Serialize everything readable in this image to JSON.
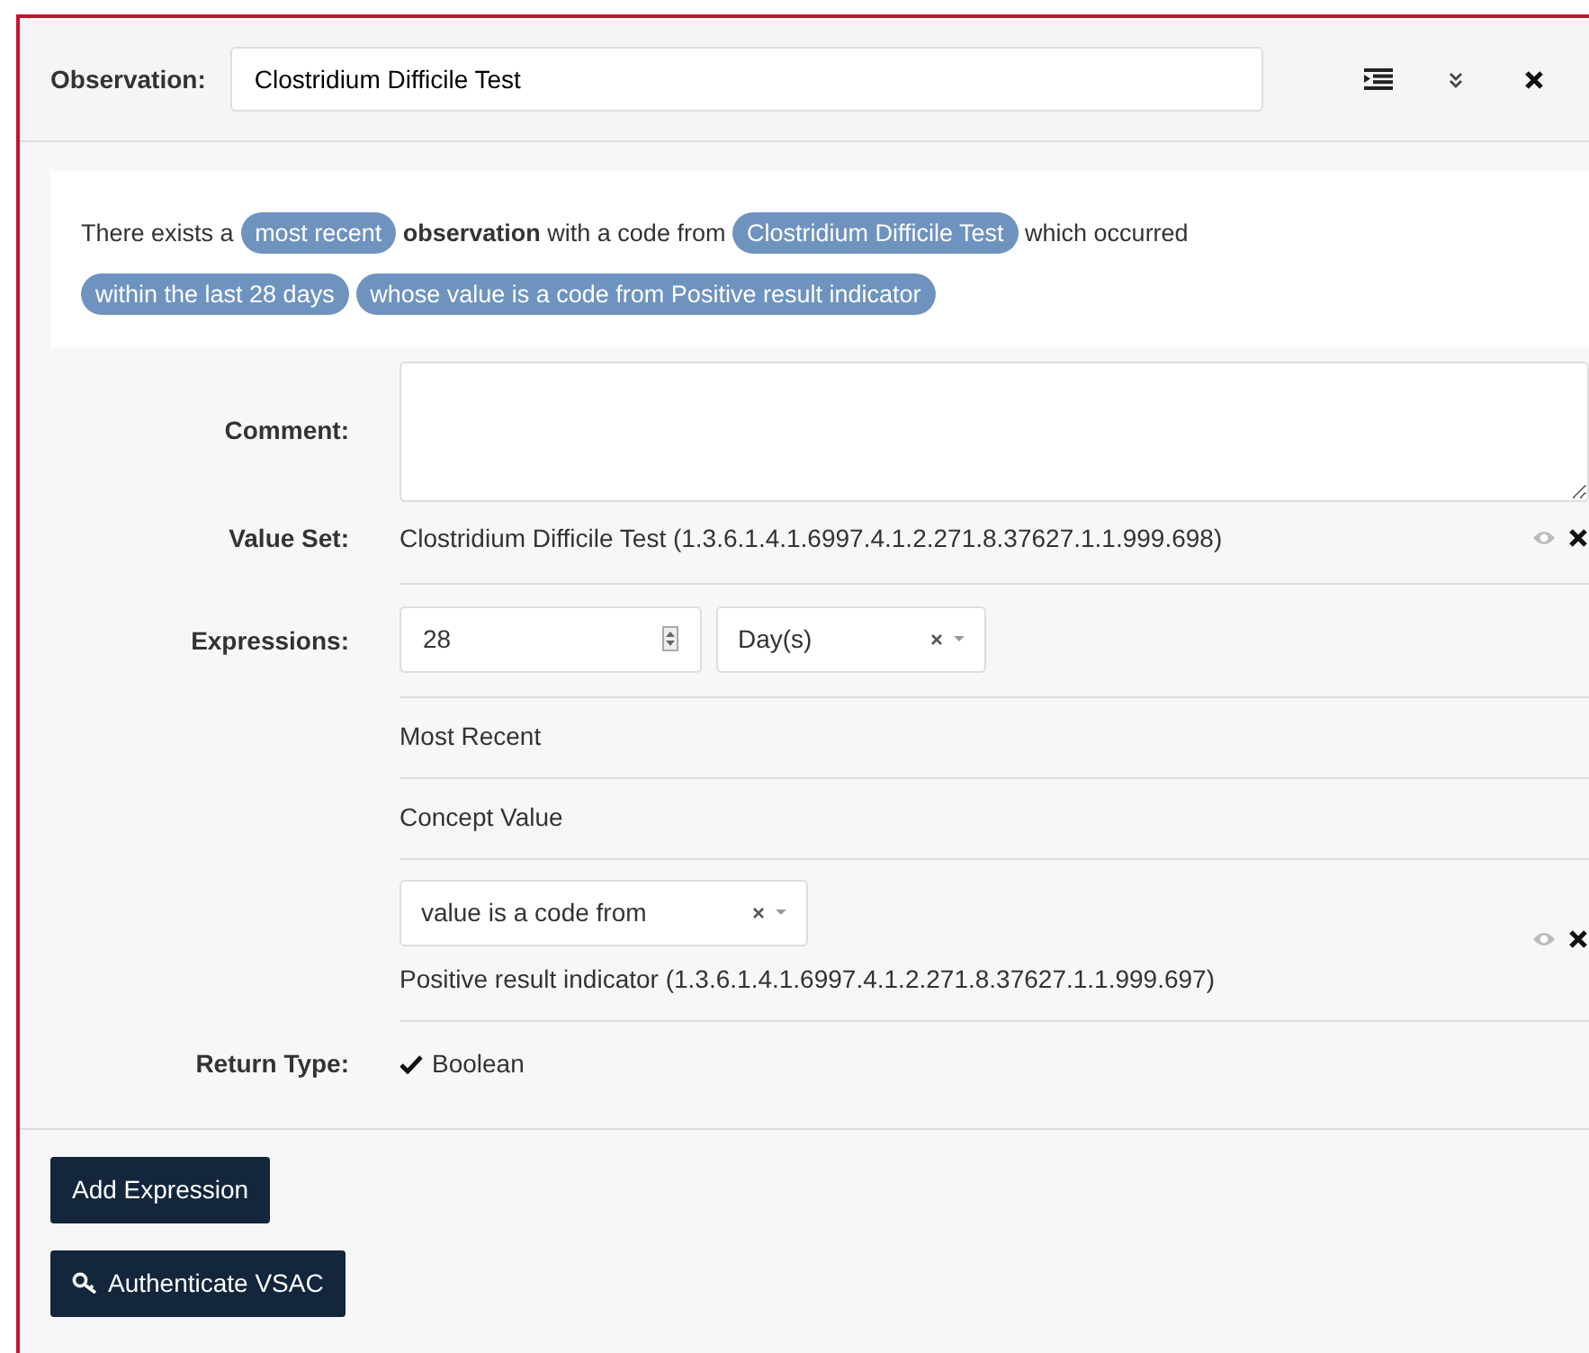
{
  "header": {
    "label": "Observation:",
    "value": "Clostridium Difficile Test"
  },
  "summary": [
    {
      "kind": "text",
      "text": "There exists a"
    },
    {
      "kind": "pill",
      "text": "most recent"
    },
    {
      "kind": "bold",
      "text": "observation"
    },
    {
      "kind": "text",
      "text": "with a code from"
    },
    {
      "kind": "pill",
      "text": "Clostridium Difficile Test"
    },
    {
      "kind": "text",
      "text": "which occurred"
    },
    {
      "kind": "pill",
      "text": "within the last 28 days"
    },
    {
      "kind": "pill",
      "text": "whose value is a code from Positive result indicator"
    }
  ],
  "fields": [
    {
      "kind": "textarea",
      "label": "Comment:"
    },
    {
      "kind": "valueset",
      "label": "Value Set:",
      "text": "Clostridium Difficile Test (1.3.6.1.4.1.6997.4.1.2.271.8.37627.1.1.999.698)"
    },
    {
      "kind": "expressions",
      "label": "Expressions:",
      "items": [
        {
          "kind": "quantity",
          "value": "28",
          "unit": "Day(s)"
        },
        {
          "kind": "text",
          "text": "Most Recent"
        },
        {
          "kind": "text",
          "text": "Concept Value"
        },
        {
          "kind": "concept",
          "operator": "value is a code from",
          "valueset": "Positive result indicator (1.3.6.1.4.1.6997.4.1.2.271.8.37627.1.1.999.697)"
        }
      ]
    },
    {
      "kind": "check",
      "label": "Return Type:",
      "text": "Boolean"
    }
  ],
  "buttons": [
    {
      "kind": "plain",
      "label": "Add Expression"
    },
    {
      "kind": "key",
      "label": "Authenticate VSAC"
    }
  ]
}
